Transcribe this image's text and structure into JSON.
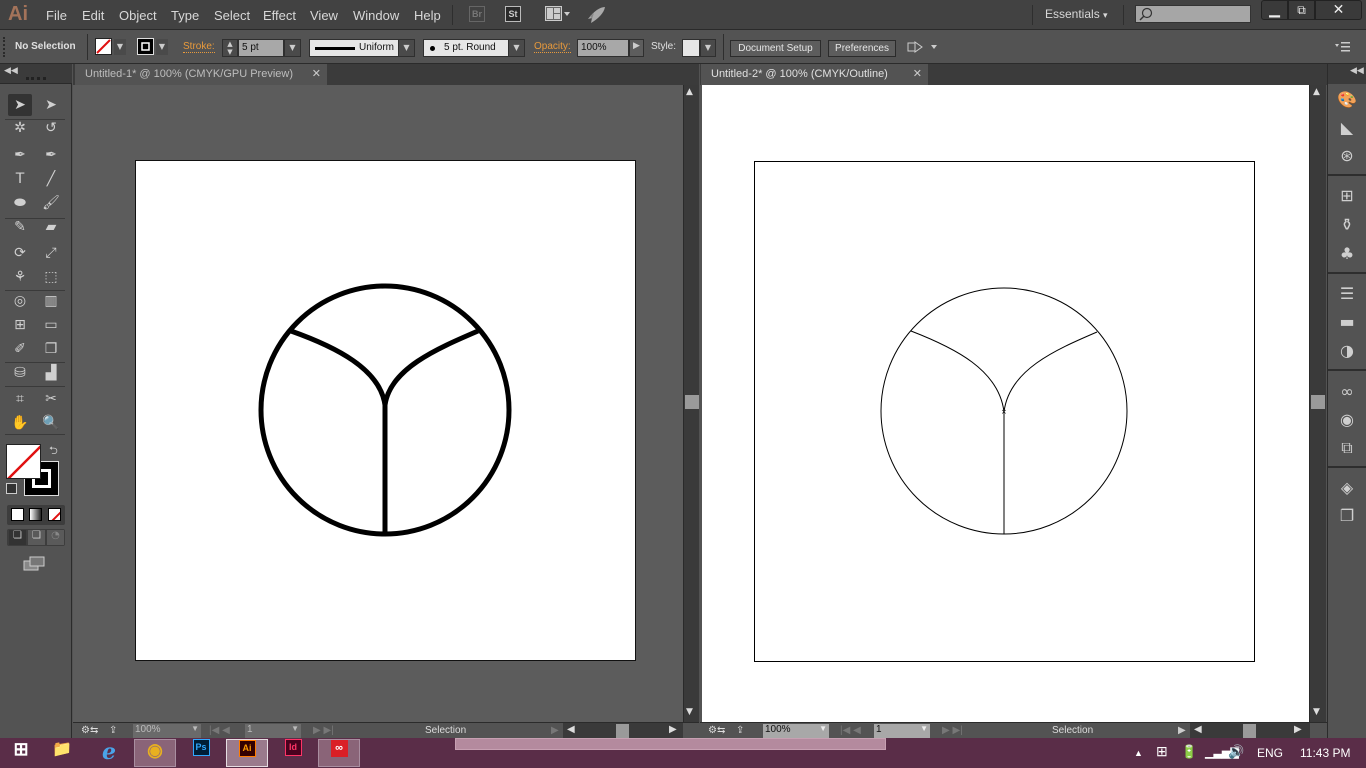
{
  "app": {
    "logo": "Ai",
    "brand_color": "#a4735a"
  },
  "menubar": {
    "items": [
      "File",
      "Edit",
      "Object",
      "Type",
      "Select",
      "Effect",
      "View",
      "Window",
      "Help"
    ],
    "app_buttons": {
      "bridge": "Br",
      "stock": "St"
    },
    "workspace": "Essentials",
    "search_placeholder": "",
    "window_controls": {
      "minimize": "minimize-icon",
      "restore": "restore-icon",
      "close": "close-icon"
    }
  },
  "control_bar": {
    "selection_label": "No Selection",
    "stroke_label": "Stroke:",
    "stroke_weight": "5 pt",
    "profile": "Uniform",
    "brush": "5 pt. Round",
    "opacity_label": "Opacity:",
    "opacity_value": "100%",
    "style_label": "Style:",
    "document_setup": "Document Setup",
    "preferences": "Preferences",
    "accent_color": "#e89a3c"
  },
  "tools": [
    {
      "name": "selection-tool",
      "glyph": "➤"
    },
    {
      "name": "direct-selection-tool",
      "glyph": "➤"
    },
    {
      "name": "magic-wand-tool",
      "glyph": "✲"
    },
    {
      "name": "lasso-tool",
      "glyph": "↺"
    },
    {
      "name": "pen-tool",
      "glyph": "✒"
    },
    {
      "name": "curvature-tool",
      "glyph": "✒"
    },
    {
      "name": "type-tool",
      "glyph": "T"
    },
    {
      "name": "line-tool",
      "glyph": "╱"
    },
    {
      "name": "ellipse-tool",
      "glyph": "⬬"
    },
    {
      "name": "paintbrush-tool",
      "glyph": "🖌"
    },
    {
      "name": "pencil-tool",
      "glyph": "✎"
    },
    {
      "name": "eraser-tool",
      "glyph": "▰"
    },
    {
      "name": "rotate-tool",
      "glyph": "⟳"
    },
    {
      "name": "scale-tool",
      "glyph": "⤢"
    },
    {
      "name": "puppet-warp-tool",
      "glyph": "⚘"
    },
    {
      "name": "free-transform-tool",
      "glyph": "⬚"
    },
    {
      "name": "shape-builder-tool",
      "glyph": "◎"
    },
    {
      "name": "chart-tool",
      "glyph": "▥"
    },
    {
      "name": "mesh-tool",
      "glyph": "⊞"
    },
    {
      "name": "gradient-tool",
      "glyph": "▭"
    },
    {
      "name": "eyedropper-tool",
      "glyph": "✐"
    },
    {
      "name": "blend-tool",
      "glyph": "❐"
    },
    {
      "name": "symbol-sprayer-tool",
      "glyph": "⛁"
    },
    {
      "name": "column-graph-tool",
      "glyph": "▟"
    },
    {
      "name": "artboard-tool",
      "glyph": "⌗"
    },
    {
      "name": "slice-tool",
      "glyph": "✂"
    },
    {
      "name": "hand-tool",
      "glyph": "✋"
    },
    {
      "name": "zoom-tool",
      "glyph": "🔍"
    }
  ],
  "documents": [
    {
      "tab": "Untitled-1* @ 100% (CMYK/GPU Preview)",
      "zoom": "100%",
      "page": "1",
      "status": "Selection",
      "mode": "preview"
    },
    {
      "tab": "Untitled-2* @ 100% (CMYK/Outline)",
      "zoom": "100%",
      "page": "1",
      "status": "Selection",
      "mode": "outline"
    }
  ],
  "right_panel_icons": [
    "color-icon",
    "color-guide-icon",
    "cc-libraries-link-icon",
    "swatches-icon",
    "brushes-icon",
    "symbols-icon",
    "stroke-icon",
    "gradient-icon",
    "transparency-icon",
    "cc-libraries-icon",
    "appearance-icon",
    "transform-icon",
    "layers-icon",
    "artboards-icon"
  ],
  "taskbar": {
    "apps": [
      {
        "name": "start",
        "label": "⊞"
      },
      {
        "name": "file-explorer",
        "label": "📁"
      },
      {
        "name": "internet-explorer",
        "label": "e"
      },
      {
        "name": "chrome",
        "label": "◉"
      },
      {
        "name": "photoshop",
        "label": "Ps"
      },
      {
        "name": "illustrator",
        "label": "Ai"
      },
      {
        "name": "indesign",
        "label": "Id"
      },
      {
        "name": "creative-cloud",
        "label": "∞"
      }
    ],
    "language": "ENG",
    "time": "11:43 PM",
    "bg_color": "#5a2d48"
  }
}
